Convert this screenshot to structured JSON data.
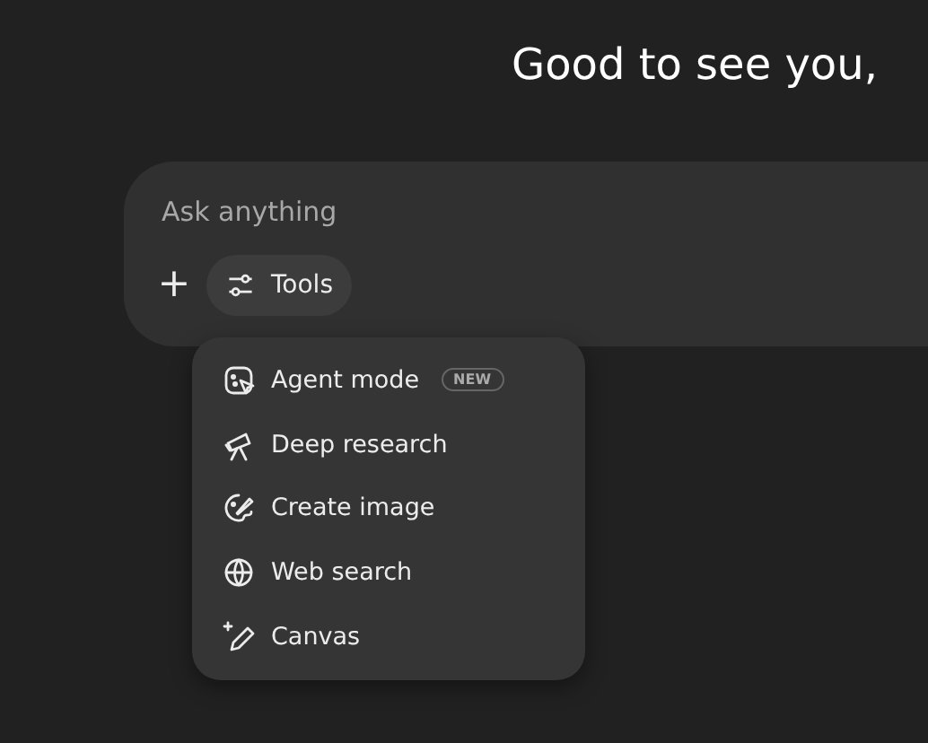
{
  "greeting": "Good to see you,",
  "composer": {
    "placeholder": "Ask anything",
    "add_button": "+",
    "tools_button": "Tools"
  },
  "tools_menu": [
    {
      "label": "Agent mode",
      "badge": "NEW"
    },
    {
      "label": "Deep research"
    },
    {
      "label": "Create image"
    },
    {
      "label": "Web search"
    },
    {
      "label": "Canvas"
    }
  ]
}
